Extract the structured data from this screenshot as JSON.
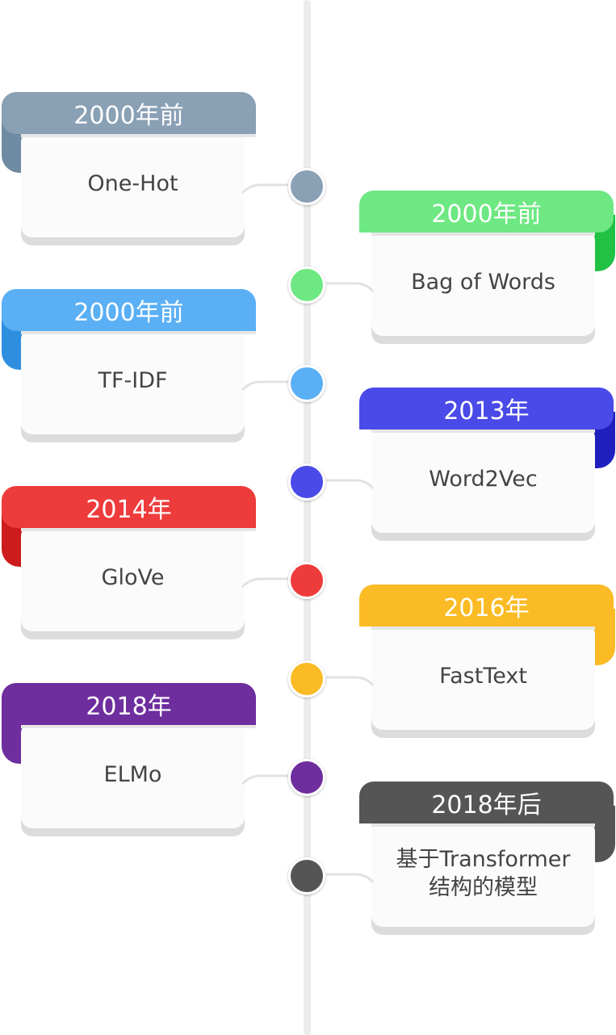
{
  "items": [
    {
      "date": "2000年前",
      "label": "One-Hot",
      "color": "#8aa0b5",
      "fold_color": "#6f8aa3"
    },
    {
      "date": "2000年前",
      "label": "Bag of Words",
      "color": "#6ee882",
      "fold_color": "#20c144"
    },
    {
      "date": "2000年前",
      "label": "TF-IDF",
      "color": "#5aaff5",
      "fold_color": "#2e8fe0"
    },
    {
      "date": "2013年",
      "label": "Word2Vec",
      "color": "#4a4ae8",
      "fold_color": "#1f1fbd"
    },
    {
      "date": "2014年",
      "label": "GloVe",
      "color": "#ee3b3b",
      "fold_color": "#cc1c1c"
    },
    {
      "date": "2016年",
      "label": "FastText",
      "color": "#fbbb25",
      "fold_color": "#fbbb25"
    },
    {
      "date": "2018年",
      "label": "ELMo",
      "color": "#6e2e9e",
      "fold_color": "#6e2e9e"
    },
    {
      "date": "2018年后",
      "label": "基于Transformer\n结构的模型",
      "color": "#555555",
      "fold_color": "#555555"
    }
  ]
}
